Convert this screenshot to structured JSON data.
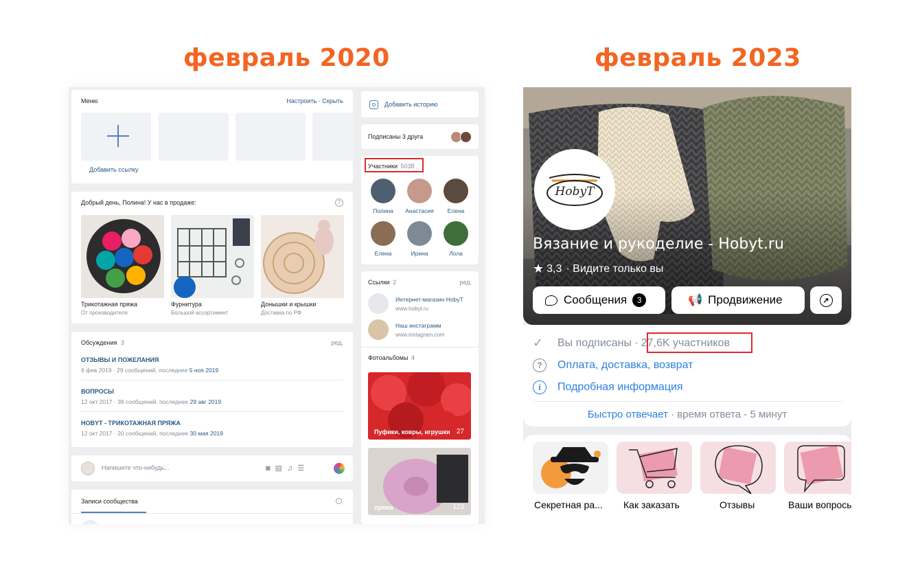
{
  "headings": {
    "left": "февраль 2020",
    "right": "февраль 2023"
  },
  "colors": {
    "accent_orange": "#f26522",
    "vk_blue": "#2a5885",
    "highlight_red": "#e0282e"
  },
  "left": {
    "menu": {
      "title": "Меню",
      "actions": "Настроить · Скрыть",
      "add_link_label": "Добавить ссылку"
    },
    "greeting": "Добрый день, Полина! У нас в продаже:",
    "products": [
      {
        "name": "Трикотажная пряжа",
        "sub": "От производителя"
      },
      {
        "name": "Фурнитура",
        "sub": "Большой ассортимент"
      },
      {
        "name": "Донышки и крышки",
        "sub": "Доставка по РФ"
      }
    ],
    "discussions": {
      "title": "Обсуждения",
      "count": "3",
      "edit": "ред.",
      "items": [
        {
          "title": "ОТЗЫВЫ И ПОЖЕЛАНИЯ",
          "meta": "9 фев 2019  ·  29 сообщений, последнее",
          "last": "5 ноя 2019"
        },
        {
          "title": "ВОПРОСЫ",
          "meta": "12 окт 2017  ·  39 сообщений, последнее",
          "last": "29 авг 2019"
        },
        {
          "title": "HOBYT - ТРИКОТАЖНАЯ ПРЯЖА",
          "meta": "12 окт 2017  ·  20 сообщений, последнее",
          "last": "30 мая 2019"
        }
      ]
    },
    "composer_placeholder": "Напишите что-нибудь...",
    "wall_tab": "Записи сообщества",
    "add_story": "Добавить историю",
    "subscribed_friends": "Подписаны 3 друга",
    "members": {
      "title": "Участники",
      "count": "5038",
      "names": [
        "Полина",
        "Анастасия",
        "Елена",
        "Елена",
        "Ирина",
        "Лола"
      ]
    },
    "links": {
      "title": "Ссылки",
      "count": "2",
      "edit": "ред.",
      "items": [
        {
          "name": "Интернет-магазин HobyT",
          "url": "www.hobyt.ru"
        },
        {
          "name": "Наш инстаграмм",
          "url": "www.instagram.com"
        }
      ]
    },
    "albums": {
      "title": "Фотоальбомы",
      "count": "4",
      "items": [
        {
          "name": "Пуфики, ковры, игрушки",
          "count": "27"
        },
        {
          "name": "пряжа",
          "count": "123"
        }
      ]
    }
  },
  "right": {
    "community_name": "Вязание и рукоделие - Hobyt.ru",
    "rating": "3,3",
    "visibility": "· Видите только вы",
    "logo_text": "HobyT",
    "buttons": {
      "messages": "Сообщения",
      "messages_badge": "3",
      "promotion": "Продвижение"
    },
    "subscribed": "Вы подписаны ·",
    "members_count": "27,6K участников",
    "payment": "Оплата, доставка, возврат",
    "details": "Подробная информация",
    "fast_reply": "Быстро отвечает",
    "reply_time": " · время ответа - 5 минут",
    "stories": [
      "Секретная ра...",
      "Как заказать",
      "Отзывы",
      "Ваши вопросы"
    ]
  }
}
